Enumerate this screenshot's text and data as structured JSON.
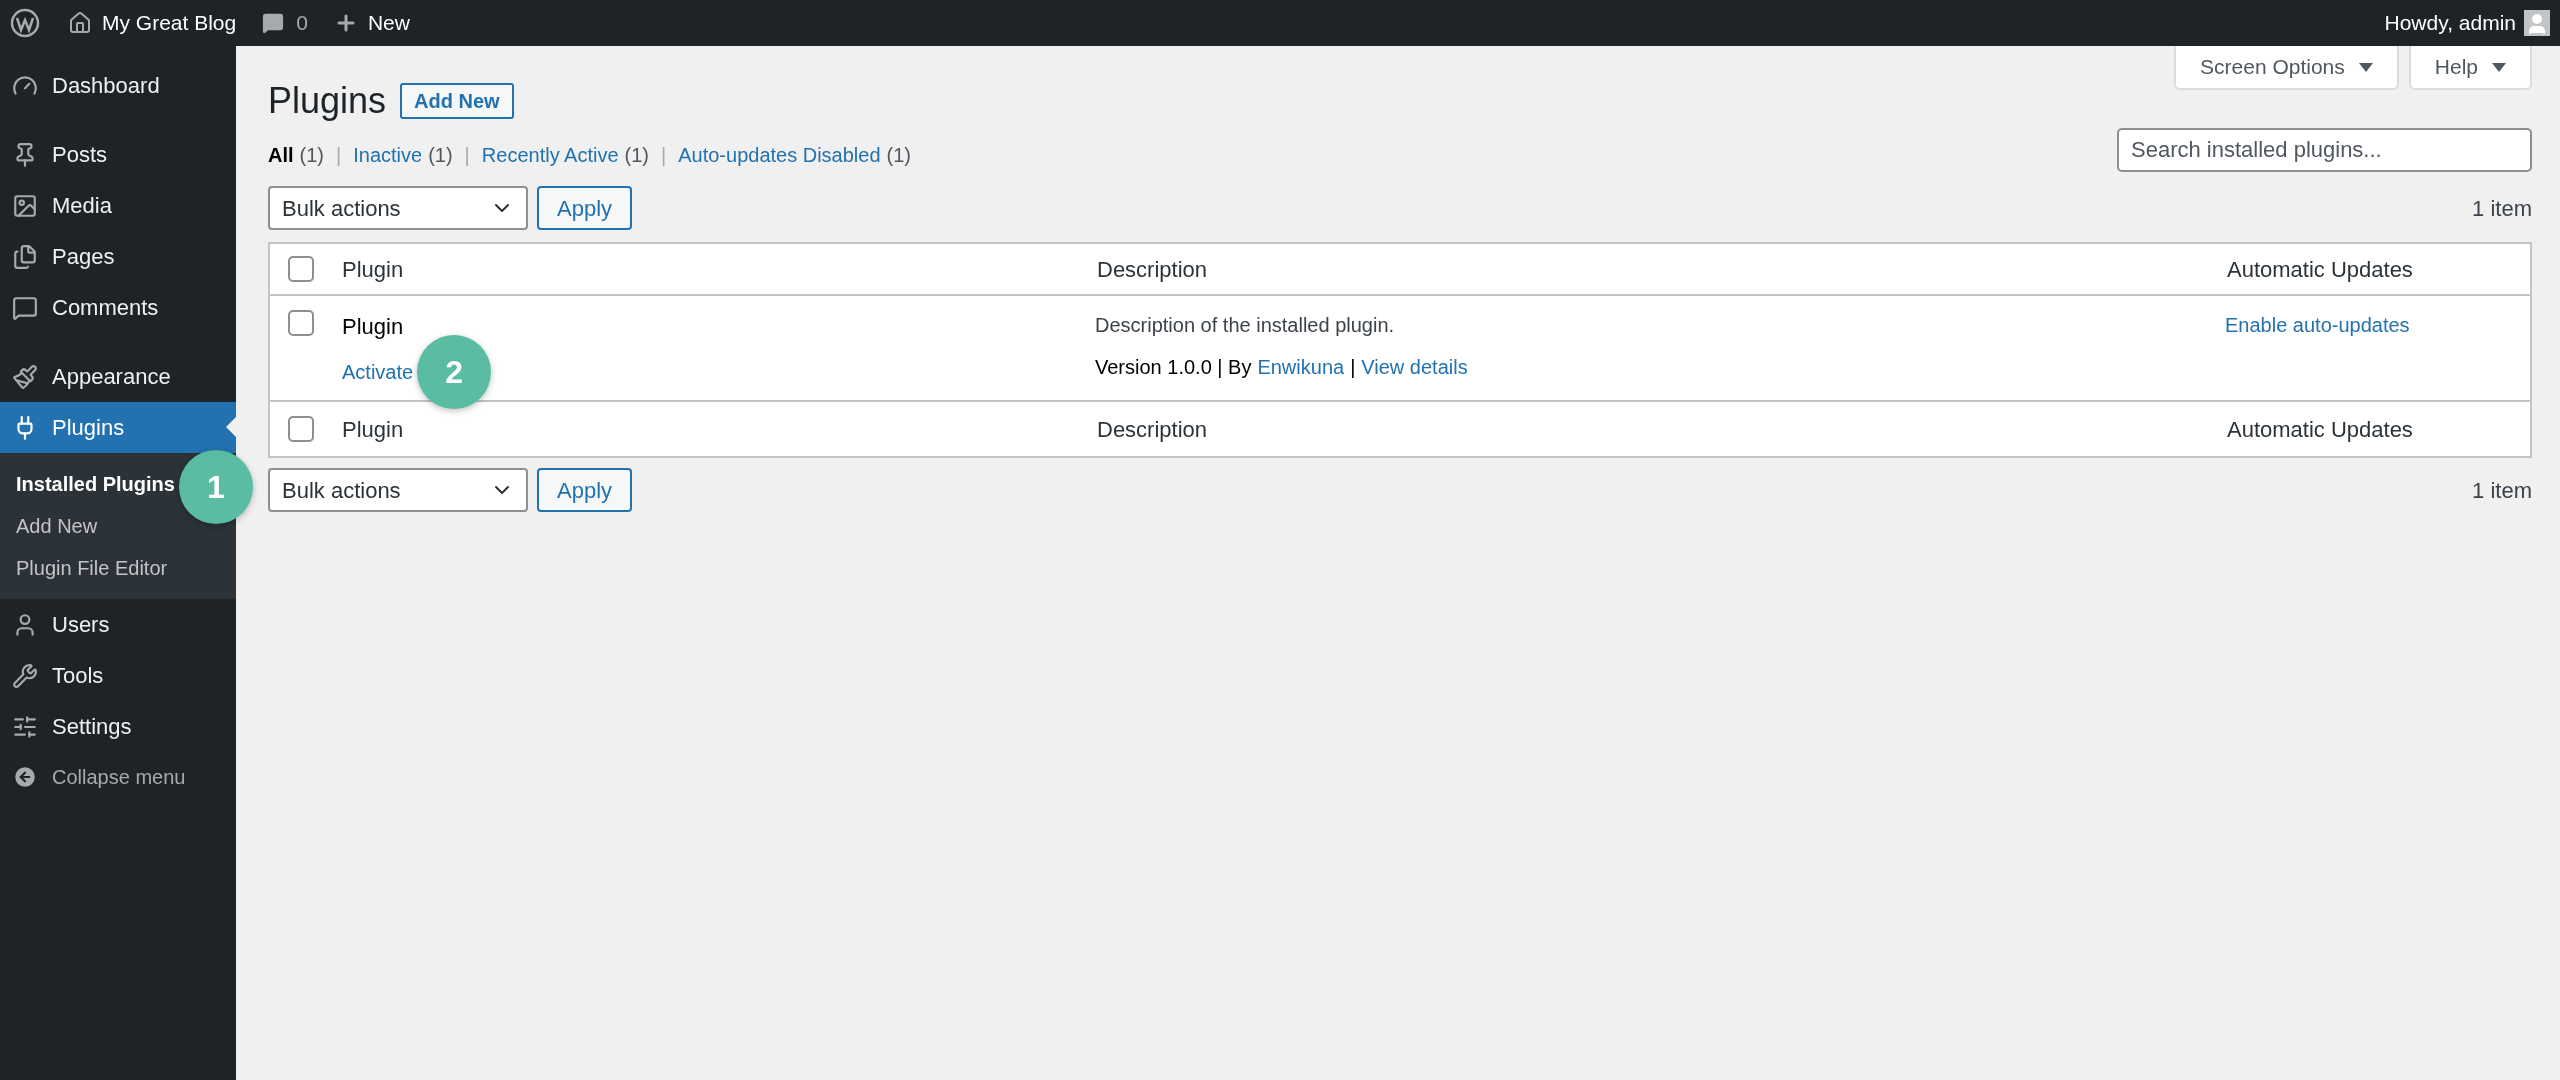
{
  "admin_bar": {
    "site_name": "My Great Blog",
    "comments_count": "0",
    "new_label": "New",
    "greeting": "Howdy, admin"
  },
  "sidebar": {
    "groups": [
      [
        {
          "label": "Dashboard",
          "selected": false
        }
      ],
      [
        {
          "label": "Posts",
          "selected": false
        },
        {
          "label": "Media",
          "selected": false
        },
        {
          "label": "Pages",
          "selected": false
        },
        {
          "label": "Comments",
          "selected": false
        }
      ],
      [
        {
          "label": "Appearance",
          "selected": false
        },
        {
          "label": "Plugins",
          "selected": true,
          "children": [
            {
              "label": "Installed Plugins",
              "selected": true
            },
            {
              "label": "Add New",
              "selected": false
            },
            {
              "label": "Plugin File Editor",
              "selected": false
            }
          ]
        },
        {
          "label": "Users",
          "selected": false
        },
        {
          "label": "Tools",
          "selected": false
        },
        {
          "label": "Settings",
          "selected": false
        }
      ]
    ],
    "collapse_label": "Collapse menu"
  },
  "screen_tabs": [
    {
      "label": "Screen Options"
    },
    {
      "label": "Help"
    }
  ],
  "page": {
    "title": "Plugins",
    "add_new": "Add New"
  },
  "filters": [
    {
      "label": "All",
      "count": "(1)",
      "selected": true,
      "separator": "|"
    },
    {
      "label": "Inactive",
      "count": "(1)",
      "selected": false,
      "separator": "|"
    },
    {
      "label": "Recently Active",
      "count": "(1)",
      "selected": false,
      "separator": "|"
    },
    {
      "label": "Auto-updates Disabled",
      "count": "(1)",
      "selected": false
    }
  ],
  "search": {
    "placeholder": "Search installed plugins..."
  },
  "tablenav_top": {
    "bulk_select": "Bulk actions",
    "apply": "Apply",
    "count": "1 item"
  },
  "table": {
    "header": {
      "checked": false,
      "columns": [
        "Plugin",
        "Description",
        "Automatic Updates"
      ]
    },
    "rows": [
      {
        "checked": false,
        "name": "Plugin",
        "action": "Activate",
        "description": "Description of the installed plugin.",
        "meta_text": "Version 1.0.0 | By",
        "author": "Enwikuna",
        "meta_separator": "|",
        "details": "View details",
        "auto_update": "Enable auto-updates"
      }
    ],
    "footer": {
      "checked": false,
      "columns": [
        "Plugin",
        "Description",
        "Automatic Updates"
      ]
    }
  },
  "tablenav_bottom": {
    "bulk_select": "Bulk actions",
    "apply": "Apply",
    "count": "1 item"
  },
  "callouts": [
    {
      "label": "1"
    },
    {
      "label": "2"
    }
  ]
}
